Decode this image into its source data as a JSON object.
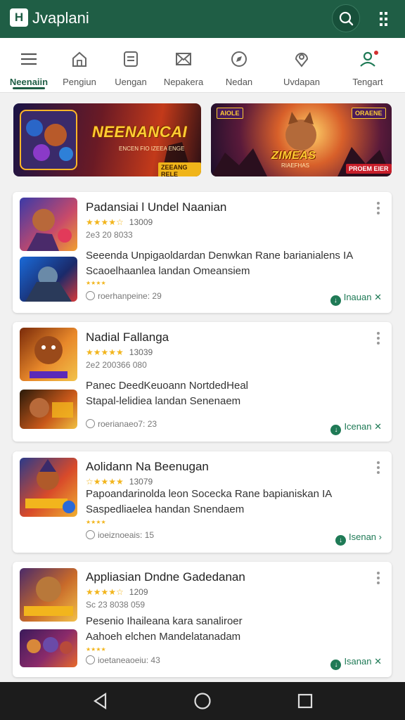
{
  "app": {
    "title": "Jvaplani",
    "logo_text": "H"
  },
  "colors": {
    "primary": "#1f5e45",
    "accent": "#1f7a56",
    "star": "#f2b51d",
    "nav_bar": "#1c1c1c"
  },
  "header_icons": {
    "search": "search-icon",
    "menu": "more-vertical-icon"
  },
  "tabs": [
    {
      "label": "Neenaiin",
      "icon": "menu-icon",
      "active": true
    },
    {
      "label": "Pengiun",
      "icon": "home-icon"
    },
    {
      "label": "Uengan",
      "icon": "document-icon"
    },
    {
      "label": "Nepakera",
      "icon": "envelope-icon"
    },
    {
      "label": "Nedan",
      "icon": "compass-icon"
    },
    {
      "label": "Uvdapan",
      "icon": "location-icon"
    },
    {
      "label": "Tengart",
      "icon": "user-icon",
      "badge": true
    }
  ],
  "banners": [
    {
      "title": "NEENANCAI",
      "subtitle": "ENCEN FIO IZEEA ENGE",
      "tag": "ZEEANG RELE"
    },
    {
      "title": "ZIMEAS",
      "subtitle": "RIAEFHAS",
      "tag": "PROEM EIER",
      "top_badges": [
        "AIOLE",
        "ORAENE"
      ]
    }
  ],
  "apps": [
    {
      "title": "Padansiai l Undel Naanian",
      "rating_count": "13009",
      "meta": "2e3 20 8033",
      "desc1": "Seeenda Unpigaoldardan Denwkan Rane barianialens IA",
      "desc2": "Scaoelhaanlea landan  Omeansiem",
      "size": "roerhanpeine: 29",
      "install": "Inauan"
    },
    {
      "title": "Nadial Fallanga",
      "rating_count": "13039",
      "meta": "2e2 200366 080",
      "desc1": "Panec DeedKeuoann NortdedHeal",
      "desc2": "Stapal-lelidiea landan  Senenaem",
      "size": "roerianaeo7: 23",
      "install": "Icenan"
    },
    {
      "title": "Aolidann Na Beenugan",
      "rating_count": "13079",
      "meta": "",
      "desc1": "Papoandarinolda leon Socecka Rane bapianiskan IA",
      "desc2": "Saspedliaelea handan  Snendaem",
      "size": "ioeiznoeais: 15",
      "install": "Isenan"
    },
    {
      "title": "Appliasian Dndne Gadedanan",
      "rating_count": "1209",
      "meta": "Sc 23 8038 059",
      "desc1": "Pesenio Ihaileana kara sanaliroer",
      "desc2": "Aahoeh elchen Mandelatanadam",
      "size": "ioetaneaoeiu: 43",
      "install": "Isanan"
    }
  ],
  "system_nav": {
    "back": "back-triangle-icon",
    "home": "home-circle-icon",
    "recents": "recents-square-icon"
  }
}
